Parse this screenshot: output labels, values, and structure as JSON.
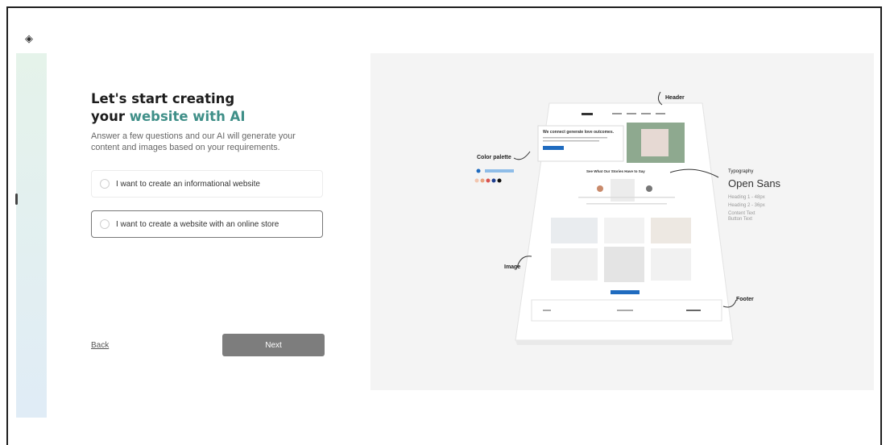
{
  "header": {
    "logo_icon": "diamond-logo-icon"
  },
  "wizard": {
    "title_line1": "Let's start creating",
    "title_line2_prefix": "your ",
    "title_line2_accent": "website with AI",
    "subtitle": "Answer a few questions and our AI will generate your content and images based on your requirements.",
    "options": [
      {
        "label": "I want to create an informational website",
        "selected": false
      },
      {
        "label": "I want to create a website with an online store",
        "selected": false
      }
    ],
    "back_label": "Back",
    "next_label": "Next"
  },
  "preview": {
    "annotations": {
      "header": "Header",
      "color_palette": "Color palette",
      "typography": "Typography",
      "image": "Image",
      "footer": "Footer"
    },
    "font_name": "Open Sans",
    "font_meta": [
      "Heading 1 - 48px",
      "Heading 2 - 36px",
      "Content Text",
      "Button Text"
    ],
    "hero_text": "We connect generate love outcomes.",
    "section_title": "See What Our Stories Have to Say",
    "colors": {
      "accent": "#3f8f88",
      "blue": "#1f6bbf",
      "swatches": [
        "#f2c6b0",
        "#e8a27e",
        "#d9534f",
        "#1f3f8f",
        "#111111"
      ]
    }
  }
}
